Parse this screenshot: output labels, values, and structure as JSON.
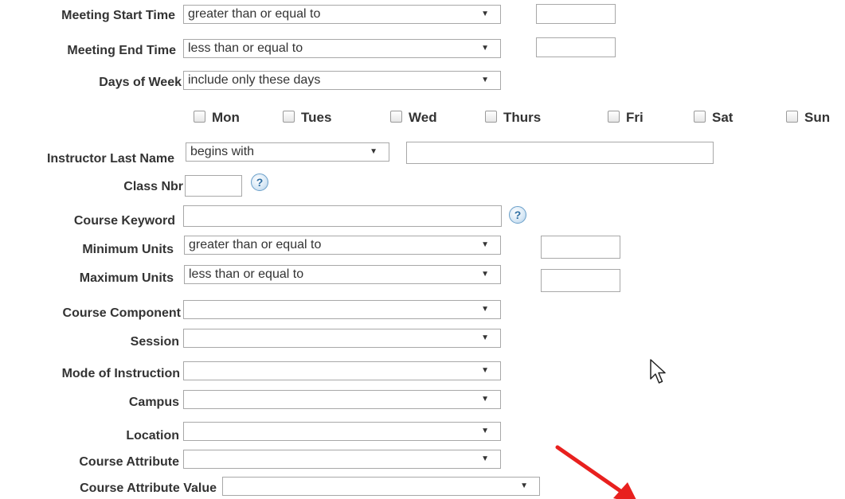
{
  "fields": {
    "meeting_start_time": {
      "label": "Meeting Start Time",
      "operator": "greater than or equal to",
      "value": ""
    },
    "meeting_end_time": {
      "label": "Meeting End Time",
      "operator": "less than or equal to",
      "value": ""
    },
    "days_of_week": {
      "label": "Days of Week",
      "operator": "include only these days",
      "days": [
        "Mon",
        "Tues",
        "Wed",
        "Thurs",
        "Fri",
        "Sat",
        "Sun"
      ]
    },
    "instructor_last_name": {
      "label": "Instructor Last Name",
      "operator": "begins with",
      "value": ""
    },
    "class_nbr": {
      "label": "Class Nbr",
      "value": ""
    },
    "course_keyword": {
      "label": "Course Keyword",
      "value": ""
    },
    "minimum_units": {
      "label": "Minimum Units",
      "operator": "greater than or equal to",
      "value": ""
    },
    "maximum_units": {
      "label": "Maximum Units",
      "operator": "less than or equal to",
      "value": ""
    },
    "course_component": {
      "label": "Course Component",
      "value": ""
    },
    "session": {
      "label": "Session",
      "value": ""
    },
    "mode_of_instruction": {
      "label": "Mode of Instruction",
      "value": ""
    },
    "campus": {
      "label": "Campus",
      "value": ""
    },
    "location": {
      "label": "Location",
      "value": ""
    },
    "course_attribute": {
      "label": "Course Attribute",
      "value": ""
    },
    "course_attribute_value": {
      "label": "Course Attribute Value",
      "value": ""
    }
  },
  "icons": {
    "help": "help-question-icon",
    "dropdown": "dropdown-arrow-icon",
    "cursor": "mouse-pointer-icon",
    "annotation": "red-arrow-icon"
  },
  "glyphs": {
    "dropdown_arrow": "▼",
    "help": "?"
  },
  "colors": {
    "label_text": "#333333",
    "border": "#a8a8a8",
    "help_icon": "#2f6fa3",
    "annotation_arrow": "#e8201e"
  }
}
